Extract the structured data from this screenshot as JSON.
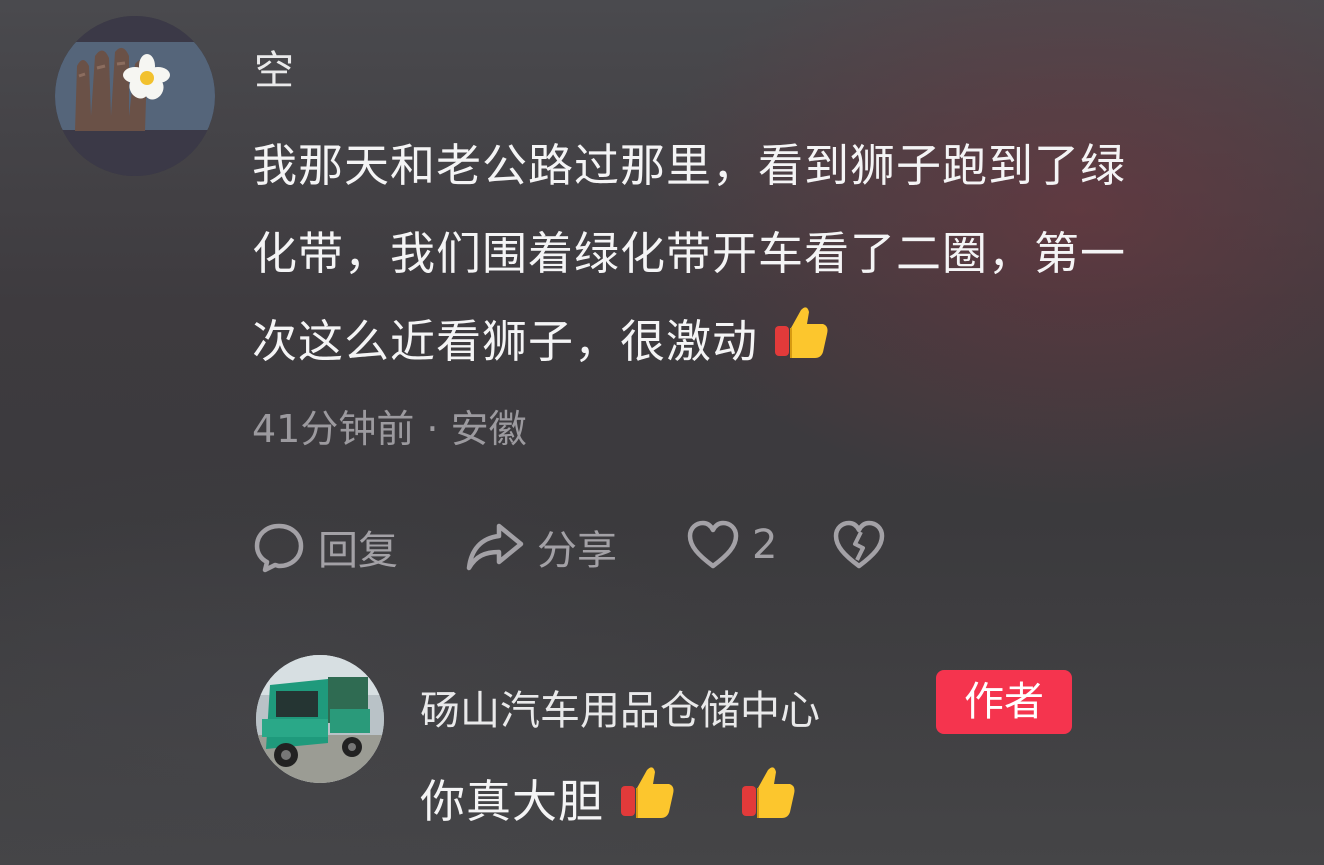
{
  "comment": {
    "username": "空",
    "lines": [
      "我那天和老公路过那里，看到狮子跑到了绿",
      "化带，我们围着绿化带开车看了二圈，第一",
      "次这么近看狮子，很激动"
    ],
    "emoji_icon": "thumbs-up-icon",
    "meta": "41分钟前 · 安徽",
    "actions": {
      "reply_label": "回复",
      "share_label": "分享",
      "like_count": "2",
      "reply_icon": "speech-bubble-icon",
      "share_icon": "share-arrow-icon",
      "like_icon": "heart-icon",
      "dislike_icon": "broken-heart-icon"
    }
  },
  "reply": {
    "username": "砀山汽车用品仓储中心",
    "badge": "作者",
    "text": "你真大胆",
    "emoji_icons": [
      "thumbs-up-icon",
      "thumbs-up-icon"
    ]
  },
  "colors": {
    "text_primary": "#f4f4f5",
    "text_secondary": "#9c9a9f",
    "badge_bg": "#f5344e"
  }
}
